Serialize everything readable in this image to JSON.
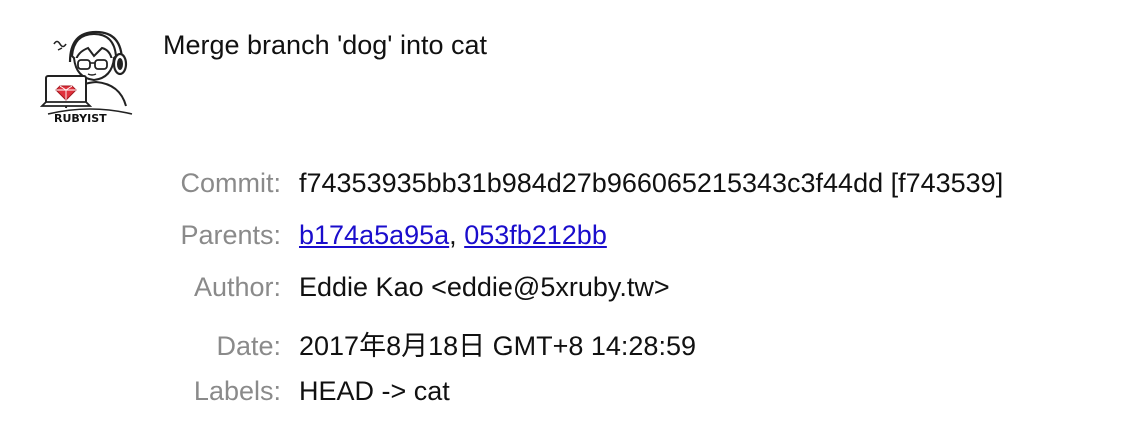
{
  "commit_view": {
    "avatar_caption": "RUBYIST",
    "subject": "Merge branch 'dog' into cat",
    "fields": {
      "commit": {
        "label": "Commit:",
        "value": "f74353935bb31b984d27b966065215343c3f44dd [f743539]"
      },
      "parents": {
        "label": "Parents:",
        "links": [
          "b174a5a95a",
          "053fb212bb"
        ],
        "separator": ", "
      },
      "author": {
        "label": "Author:",
        "value": "Eddie Kao <eddie@5xruby.tw>"
      },
      "date": {
        "label": "Date:",
        "value": "2017年8月18日 GMT+8 14:28:59"
      },
      "labels": {
        "label": "Labels:",
        "value": "HEAD -> cat"
      }
    }
  },
  "colors": {
    "label_gray": "#8a8a8a",
    "link_blue": "#1a0dcc",
    "ruby_red": "#e0313c",
    "text": "#111111"
  }
}
